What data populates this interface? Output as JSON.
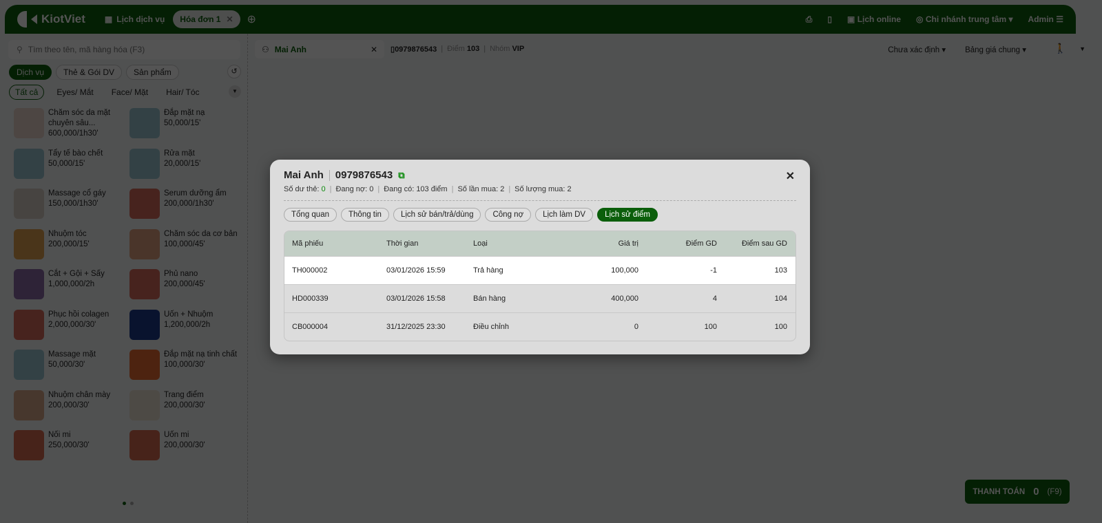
{
  "header": {
    "brand": "KiotViet",
    "schedule": "Lịch dịch vụ",
    "tab": "Hóa đơn 1",
    "online": "Lịch online",
    "branch": "Chi nhánh trung tâm",
    "user": "Admin"
  },
  "left": {
    "search_placeholder": "Tìm theo tên, mã hàng hóa (F3)",
    "groups": [
      "Dịch vụ",
      "Thẻ & Gói DV",
      "Sản phẩm"
    ],
    "categories": [
      "Tất cả",
      "Eyes/ Mắt",
      "Face/ Mặt",
      "Hair/ Tóc"
    ],
    "items": [
      {
        "name": "Chăm sóc da mặt chuyên sâu...",
        "price": "600,000/1h30'",
        "color": "#e8d4cc"
      },
      {
        "name": "Đắp mặt nạ",
        "price": "50,000/15'",
        "color": "#9cc6d2"
      },
      {
        "name": "Tẩy tế bào chết",
        "price": "50,000/15'",
        "color": "#9cc6d2"
      },
      {
        "name": "Rửa mặt",
        "price": "20,000/15'",
        "color": "#9cc6d2"
      },
      {
        "name": "Massage cổ gáy",
        "price": "150,000/1h30'",
        "color": "#d8cfc4"
      },
      {
        "name": "Serum dưỡng ẩm",
        "price": "200,000/1h30'",
        "color": "#d86a5a"
      },
      {
        "name": "Nhuộm tóc",
        "price": "200,000/15'",
        "color": "#e0a050"
      },
      {
        "name": "Chăm sóc da cơ bản",
        "price": "100,000/45'",
        "color": "#e0a080"
      },
      {
        "name": "Cắt + Gội + Sấy",
        "price": "1,000,000/2h",
        "color": "#8a6aa8"
      },
      {
        "name": "Phủ nano",
        "price": "200,000/45'",
        "color": "#d86a5a"
      },
      {
        "name": "Phục hồi colagen",
        "price": "2,000,000/30'",
        "color": "#d86a5a"
      },
      {
        "name": "Uốn + Nhuộm",
        "price": "1,200,000/2h",
        "color": "#1a3a8a"
      },
      {
        "name": "Massage mặt",
        "price": "50,000/30'",
        "color": "#9cc6d2"
      },
      {
        "name": "Đắp mặt nạ tinh chất",
        "price": "100,000/30'",
        "color": "#e86a30"
      },
      {
        "name": "Nhuộm chân mày",
        "price": "200,000/30'",
        "color": "#d8a888"
      },
      {
        "name": "Trang điểm",
        "price": "200,000/30'",
        "color": "#e8e0d0"
      },
      {
        "name": "Nối mi",
        "price": "250,000/30'",
        "color": "#d86a50"
      },
      {
        "name": "Uốn mi",
        "price": "200,000/30'",
        "color": "#d86a50"
      }
    ]
  },
  "customer": {
    "name": "Mai Anh",
    "phone": "0979876543",
    "points_label": "Điểm",
    "points": "103",
    "group_label": "Nhóm",
    "group": "VIP"
  },
  "toolbar": {
    "status": "Chưa xác định",
    "pricebook": "Bảng giá chung"
  },
  "pay": {
    "label": "THANH TOÁN",
    "amount": "0",
    "shortcut": "(F9)"
  },
  "modal": {
    "name": "Mai Anh",
    "phone": "0979876543",
    "stats": {
      "balance_label": "Số dư thẻ:",
      "balance": "0",
      "debt": "Đang nợ: 0",
      "points": "Đang có: 103 điểm",
      "purchases": "Số lần mua: 2",
      "qty": "Số lượng mua: 2"
    },
    "tabs": [
      "Tổng quan",
      "Thông tin",
      "Lịch sử bán/trả/dùng",
      "Công nợ",
      "Lịch làm DV",
      "Lịch sử điểm"
    ],
    "columns": [
      "Mã phiếu",
      "Thời gian",
      "Loại",
      "Giá trị",
      "Điểm GD",
      "Điểm sau GD"
    ],
    "rows": [
      [
        "TH000002",
        "03/01/2026 15:59",
        "Trả hàng",
        "100,000",
        "-1",
        "103"
      ],
      [
        "HD000339",
        "03/01/2026 15:58",
        "Bán hàng",
        "400,000",
        "4",
        "104"
      ],
      [
        "CB000004",
        "31/12/2025 23:30",
        "Điều chỉnh",
        "0",
        "100",
        "100"
      ]
    ]
  }
}
